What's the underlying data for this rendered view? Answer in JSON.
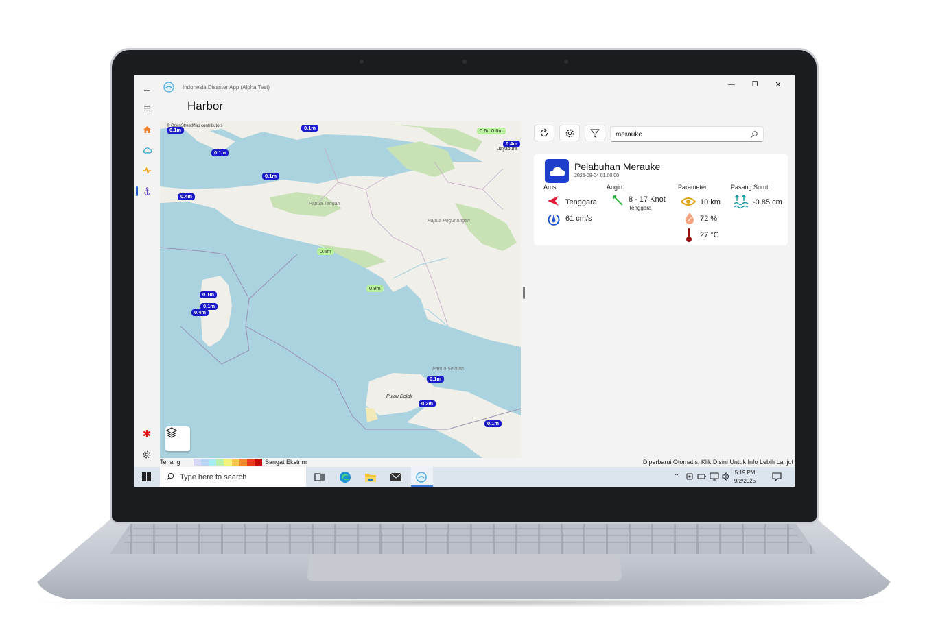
{
  "window": {
    "app_title": "Indonesia Disaster App (Alpha Test)",
    "page_title": "Harbor",
    "minimize": "—",
    "maximize": "❐",
    "close": "✕"
  },
  "nav": {
    "back": "←",
    "menu": "≡",
    "items": [
      "home-icon",
      "cloud-icon",
      "activity-icon",
      "anchor-icon"
    ],
    "bottom": [
      "asterisk-icon",
      "gear-icon"
    ]
  },
  "map": {
    "attribution": "© OpenStreetMap contributors",
    "places": [
      "Papua Tengah",
      "Papua Pegunungan",
      "Papua Selatan",
      "Pulau Dolak",
      "Jayapura"
    ],
    "wave_labels": [
      "0.1m",
      "0.1m",
      "0.1m",
      "0.1m",
      "0.4m",
      "0.6m",
      "0.6m",
      "0.4m",
      "0.5m",
      "0.9m",
      "0.1m",
      "0.1m",
      "0.4m",
      "0.1m",
      "0.2m",
      "0.1m"
    ]
  },
  "legend": {
    "left": "Tenang",
    "right": "Sangat Ekstrim",
    "colors": [
      "#d6d6f5",
      "#b8d4f4",
      "#a6ecf2",
      "#b9f0b0",
      "#f2f27a",
      "#f7c64a",
      "#f28a2e",
      "#ee3b1f",
      "#c80a0a"
    ],
    "status": "Diperbarui Otomatis, Klik Disini Untuk Info Lebih Lanjut"
  },
  "panel": {
    "search_value": "merauke",
    "card": {
      "name": "Pelabuhan Merauke",
      "date": "2025-09-04 01.00.00",
      "arus_label": "Arus:",
      "arus_dir": "Tenggara",
      "arus_speed": "61 cm/s",
      "angin_label": "Angin:",
      "angin_speed": "8 - 17 Knot",
      "angin_dir": "Tenggara",
      "param_label": "Parameter:",
      "visibility": "10 km",
      "humidity": "72 %",
      "temperature": "27 °C",
      "tide_label": "Pasang Surut:",
      "tide": "-0.85 cm"
    }
  },
  "taskbar": {
    "search_placeholder": "Type here to search",
    "time": "5:19 PM",
    "date": "9/2/2025"
  }
}
